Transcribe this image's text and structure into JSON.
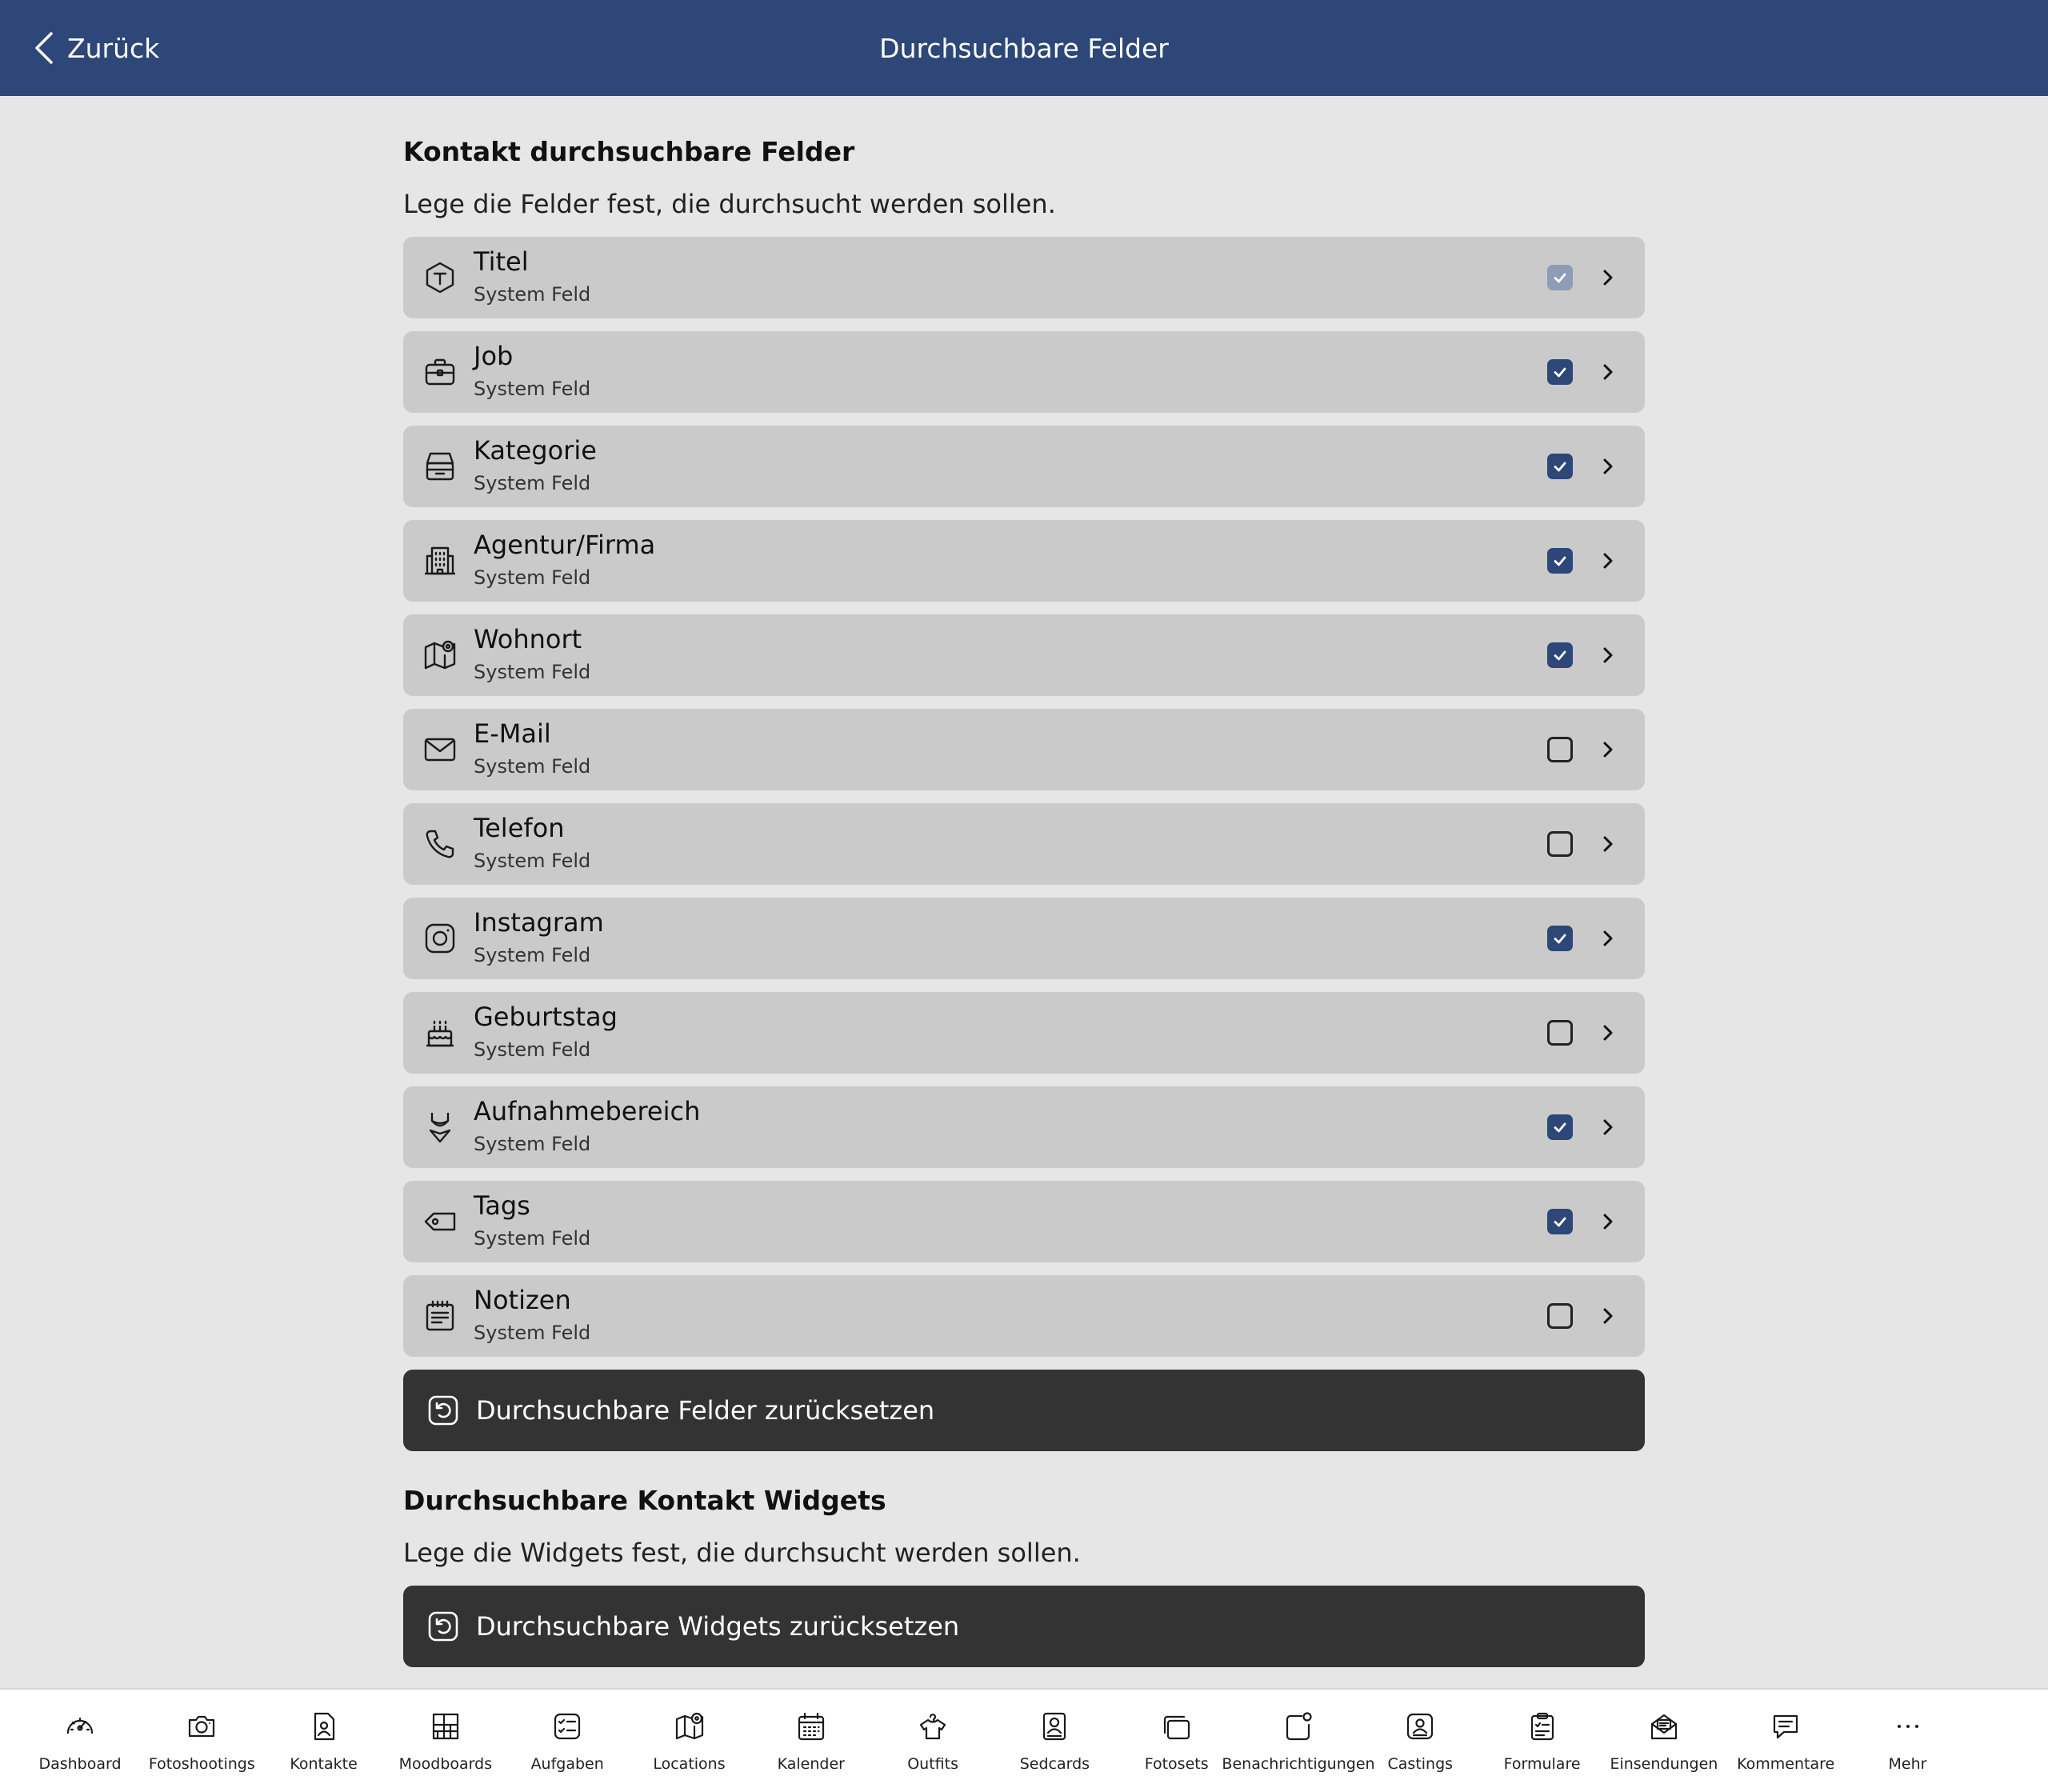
{
  "nav": {
    "back_label": "Zurück",
    "title": "Durchsuchbare Felder"
  },
  "contact_section": {
    "title": "Kontakt durchsuchbare Felder",
    "description": "Lege die Felder fest, die durchsucht werden sollen.",
    "fields": [
      {
        "key": "titel",
        "icon": "text-hexagon-icon",
        "label": "Titel",
        "subtitle": "System Feld",
        "state": "checked-disabled"
      },
      {
        "key": "job",
        "icon": "briefcase-icon",
        "label": "Job",
        "subtitle": "System Feld",
        "state": "checked"
      },
      {
        "key": "kategorie",
        "icon": "tray-icon",
        "label": "Kategorie",
        "subtitle": "System Feld",
        "state": "checked"
      },
      {
        "key": "agentur",
        "icon": "building-icon",
        "label": "Agentur/Firma",
        "subtitle": "System Feld",
        "state": "checked"
      },
      {
        "key": "wohnort",
        "icon": "map-pin-icon",
        "label": "Wohnort",
        "subtitle": "System Feld",
        "state": "checked"
      },
      {
        "key": "email",
        "icon": "mail-icon",
        "label": "E-Mail",
        "subtitle": "System Feld",
        "state": "unchecked"
      },
      {
        "key": "telefon",
        "icon": "phone-icon",
        "label": "Telefon",
        "subtitle": "System Feld",
        "state": "unchecked"
      },
      {
        "key": "instagram",
        "icon": "instagram-icon",
        "label": "Instagram",
        "subtitle": "System Feld",
        "state": "checked"
      },
      {
        "key": "geburtstag",
        "icon": "cake-icon",
        "label": "Geburtstag",
        "subtitle": "System Feld",
        "state": "unchecked"
      },
      {
        "key": "aufnahmebereich",
        "icon": "swimsuit-icon",
        "label": "Aufnahmebereich",
        "subtitle": "System Feld",
        "state": "checked"
      },
      {
        "key": "tags",
        "icon": "tag-icon",
        "label": "Tags",
        "subtitle": "System Feld",
        "state": "checked"
      },
      {
        "key": "notizen",
        "icon": "notes-icon",
        "label": "Notizen",
        "subtitle": "System Feld",
        "state": "unchecked"
      }
    ],
    "reset_button": "Durchsuchbare Felder zurücksetzen"
  },
  "widgets_section": {
    "title": "Durchsuchbare Kontakt Widgets",
    "description": "Lege die Widgets fest, die durchsucht werden sollen.",
    "reset_button": "Durchsuchbare Widgets zurücksetzen"
  },
  "tabbar": [
    {
      "key": "dashboard",
      "icon": "speedometer-icon",
      "label": "Dashboard"
    },
    {
      "key": "fotoshootings",
      "icon": "camera-icon",
      "label": "Fotoshootings"
    },
    {
      "key": "kontakte",
      "icon": "contact-file-icon",
      "label": "Kontakte"
    },
    {
      "key": "moodboards",
      "icon": "moodboard-grid-icon",
      "label": "Moodboards"
    },
    {
      "key": "aufgaben",
      "icon": "checklist-icon",
      "label": "Aufgaben"
    },
    {
      "key": "locations",
      "icon": "map-pin-icon",
      "label": "Locations"
    },
    {
      "key": "kalender",
      "icon": "calendar-icon",
      "label": "Kalender"
    },
    {
      "key": "outfits",
      "icon": "hanger-shirt-icon",
      "label": "Outfits"
    },
    {
      "key": "sedcards",
      "icon": "portrait-card-icon",
      "label": "Sedcards"
    },
    {
      "key": "fotosets",
      "icon": "stacked-photos-icon",
      "label": "Fotosets"
    },
    {
      "key": "benachrichtigungen",
      "icon": "notification-badge-icon",
      "label": "Benachrichtigungen"
    },
    {
      "key": "castings",
      "icon": "casting-card-icon",
      "label": "Castings"
    },
    {
      "key": "formulare",
      "icon": "clipboard-form-icon",
      "label": "Formulare"
    },
    {
      "key": "einsendungen",
      "icon": "open-mail-icon",
      "label": "Einsendungen"
    },
    {
      "key": "kommentare",
      "icon": "comment-icon",
      "label": "Kommentare"
    },
    {
      "key": "mehr",
      "icon": "more-dots-icon",
      "label": "Mehr"
    }
  ]
}
